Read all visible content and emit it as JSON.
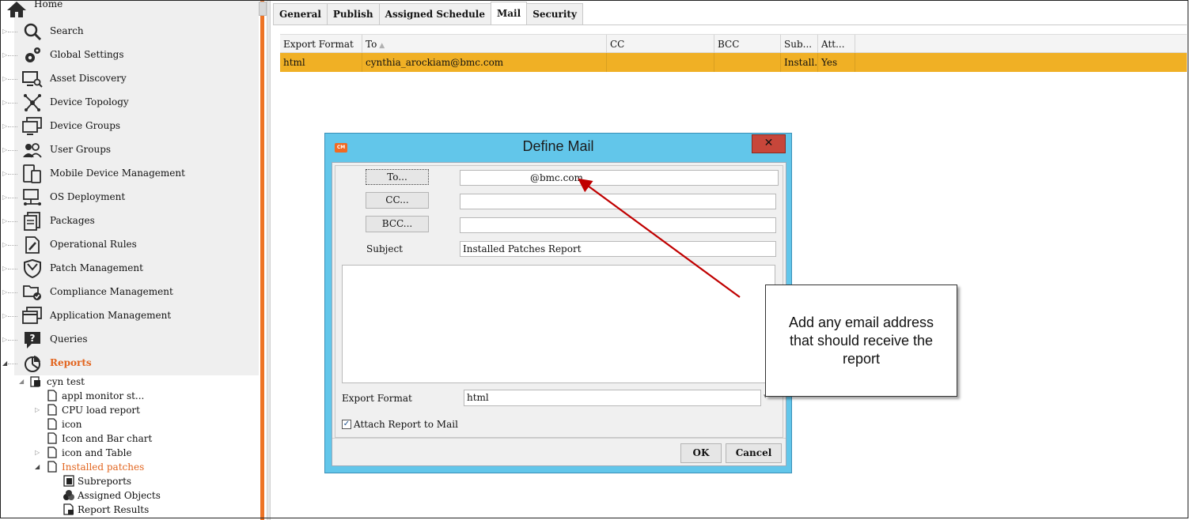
{
  "nav": {
    "items": [
      {
        "label": "Home",
        "icon": "home-icon"
      },
      {
        "label": "Search",
        "icon": "search-icon"
      },
      {
        "label": "Global Settings",
        "icon": "gears-icon"
      },
      {
        "label": "Asset Discovery",
        "icon": "monitor-search-icon"
      },
      {
        "label": "Device Topology",
        "icon": "topology-icon"
      },
      {
        "label": "Device Groups",
        "icon": "monitors-icon"
      },
      {
        "label": "User Groups",
        "icon": "users-icon"
      },
      {
        "label": "Mobile Device Management",
        "icon": "mobile-device-icon"
      },
      {
        "label": "OS Deployment",
        "icon": "os-deploy-icon"
      },
      {
        "label": "Packages",
        "icon": "packages-icon"
      },
      {
        "label": "Operational Rules",
        "icon": "rules-icon"
      },
      {
        "label": "Patch Management",
        "icon": "shield-icon"
      },
      {
        "label": "Compliance Management",
        "icon": "compliance-icon"
      },
      {
        "label": "Application Management",
        "icon": "windows-icon"
      },
      {
        "label": "Queries",
        "icon": "query-icon"
      },
      {
        "label": "Reports",
        "icon": "reports-icon"
      }
    ],
    "tree": [
      {
        "label": "cyn test",
        "icon": "folder-report-icon"
      },
      {
        "label": "appl monitor st...",
        "icon": "report-file-icon"
      },
      {
        "label": "CPU load report",
        "icon": "report-file-icon"
      },
      {
        "label": "icon",
        "icon": "report-file-icon"
      },
      {
        "label": "Icon and Bar chart",
        "icon": "report-file-icon"
      },
      {
        "label": "icon and Table",
        "icon": "report-file-icon"
      },
      {
        "label": "Installed patches",
        "icon": "report-file-icon"
      },
      {
        "label": "Subreports",
        "icon": "subreports-icon"
      },
      {
        "label": "Assigned Objects",
        "icon": "assigned-objects-icon"
      },
      {
        "label": "Report Results",
        "icon": "report-results-icon"
      }
    ]
  },
  "tabs": [
    "General",
    "Publish",
    "Assigned Schedule",
    "Mail",
    "Security"
  ],
  "active_tab": "Mail",
  "grid": {
    "columns": [
      "Export Format",
      "To",
      "CC",
      "BCC",
      "Sub...",
      "Att..."
    ],
    "rows": [
      [
        "html",
        "cynthia_arockiam@bmc.com",
        "",
        "",
        "Install...",
        "Yes"
      ]
    ]
  },
  "dialog": {
    "title": "Define Mail",
    "app_icon_text": "CM",
    "close_symbol": "✕",
    "to_button": "To...",
    "cc_button": "CC...",
    "bcc_button": "BCC...",
    "to_value": "@bmc.com",
    "cc_value": "",
    "bcc_value": "",
    "subject_label": "Subject",
    "subject_value": "Installed Patches Report",
    "body_value": "",
    "export_format_label": "Export Format",
    "export_format_value": "html",
    "attach_label": "Attach Report to Mail",
    "attach_checked": "✓",
    "ok_button": "OK",
    "cancel_button": "Cancel"
  },
  "callout": {
    "text": "Add any email address that should receive the report"
  },
  "colors": {
    "accent_orange": "#ed7325",
    "selected_row": "#f0b025",
    "dialog_frame": "#62c6ea",
    "close_button": "#c7463a",
    "arrow": "#c00000"
  }
}
